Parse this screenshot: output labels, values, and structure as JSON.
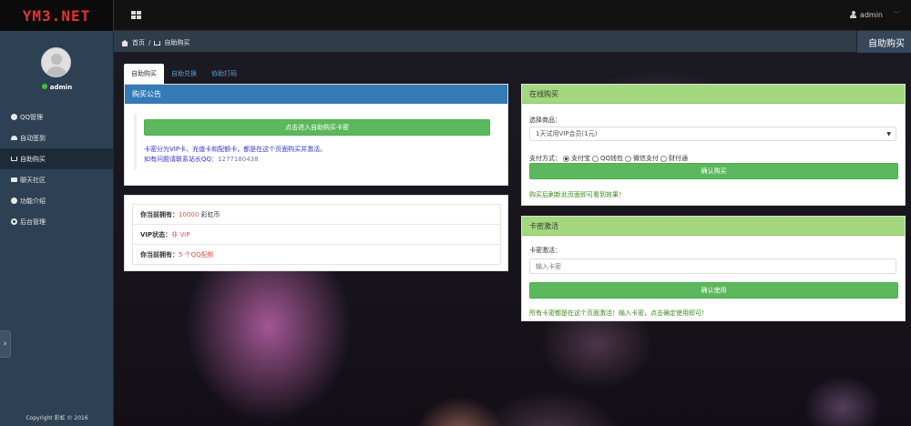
{
  "brand": "YM3.NET",
  "topbar": {
    "user": "admin"
  },
  "sidebar": {
    "user": "admin",
    "items": [
      {
        "label": "QQ管理",
        "icon": "globe-icon"
      },
      {
        "label": "自动签到",
        "icon": "cloud-icon"
      },
      {
        "label": "自助购买",
        "icon": "cart-icon"
      },
      {
        "label": "聊天社区",
        "icon": "chat-icon"
      },
      {
        "label": "功能介绍",
        "icon": "info-icon"
      },
      {
        "label": "后台管理",
        "icon": "gear-icon"
      }
    ],
    "toggle": "›",
    "copyright": "Copyright 彩虹 © 2016"
  },
  "breadcrumb": {
    "home": "首页",
    "separator": "/",
    "current": "自助购买"
  },
  "page_title": "自助购买",
  "tabs": [
    "自助购买",
    "自助兑换",
    "协助打码"
  ],
  "notice": {
    "title": "购买公告",
    "button": "点击进入自助购买卡密",
    "line1": "卡密分为VIP卡、充值卡和配额卡，都是在这个页面购买并激活。",
    "line2_prefix": "如有问题请联系站长QQ：",
    "qq": "1277180438"
  },
  "account": {
    "coins_label": "你当前拥有：",
    "coins_value": "10000",
    "coins_unit": "彩虹币",
    "vip_label": "VIP状态：",
    "vip_value": "非 VIP",
    "quota_label": "你当前拥有：",
    "quota_value": "5 个QQ配额"
  },
  "purchase": {
    "title": "在线购买",
    "product_label": "选择商品：",
    "product_value": "1天试用VIP会员(1元)",
    "payment_label": "支付方式：",
    "payment_options": [
      "支付宝",
      "QQ钱包",
      "微信支付",
      "财付通"
    ],
    "button": "确认购买",
    "note": "购买后刷新此页面即可看到效果！"
  },
  "activate": {
    "title": "卡密激活",
    "card_label": "卡密激活：",
    "card_placeholder": "输入卡密",
    "button": "确认使用",
    "note": "所有卡密都是在这个页面激活！输入卡密，点击确定使用即可！"
  },
  "colors": {
    "brand_red": "#e53333",
    "primary_blue": "#337ab7",
    "success_green": "#5cb85c",
    "panel_green": "#a3d87e"
  }
}
